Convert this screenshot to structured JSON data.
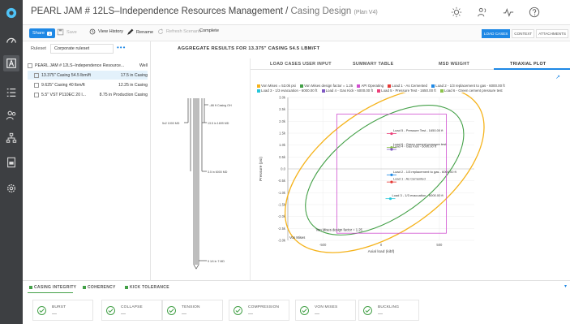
{
  "header": {
    "title": "PEARL JAM # 12LS–Independence Resources Management",
    "separator": " / ",
    "crumb": "Casing Design",
    "plan": "(Plan V4)"
  },
  "toolbar": {
    "share_label": "Share",
    "share_count": "1",
    "save_label": "Save",
    "history_label": "View History",
    "rename_label": "Rename",
    "refresh_label": "Refresh Scenario",
    "complete_label": "Complete",
    "right_tabs": [
      "LOAD CASES",
      "CONTEXT",
      "ATTACHMENTS"
    ]
  },
  "left_panel": {
    "ruleset_label": "Ruleset",
    "ruleset_value": "Corporate ruleset",
    "menu_glyph": "•••",
    "tree": [
      {
        "name": "PEARL JAM # 12LS–Independence Resource...",
        "value": "Well"
      },
      {
        "name": "13.375\" Casing 54.5 lbm/ft",
        "value": "17.5 in  Casing"
      },
      {
        "name": "9.625\" Casing 40 lbm/ft",
        "value": "12.25 in  Casing"
      },
      {
        "name": "5.5\" VST P110EC 20 l...",
        "value": "8.75 in  Production Casing"
      }
    ]
  },
  "main": {
    "title": "AGGREGATE RESULTS FOR 13.375\" CASING 54.5 LBM/FT"
  },
  "wellbore": {
    "labels": [
      "–86 ft Casing OH",
      "5x2 1000 MD",
      "13.5 in 1699 MD",
      "3.5 in 6000 MD",
      "9 1⁄4 in 7 MD"
    ]
  },
  "chart_tabs": [
    "LOAD CASES USER INPUT",
    "SUMMARY TABLE",
    "MSD WEIGHT",
    "TRIAXIAL PLOT"
  ],
  "expand_glyph": "↗",
  "legend": [
    {
      "label": "Von Mises = 53.0k psi",
      "color": "#f5b31c"
    },
    {
      "label": "Von Mises design factor = 1.25",
      "color": "#43a047"
    },
    {
      "label": "API Operating",
      "color": "#d04fd0"
    },
    {
      "label": "Load 1 - As Cemented",
      "color": "#e53935"
    },
    {
      "label": "Load 2 - 1/3 replacement to gas - 6000.00 ft",
      "color": "#1e88e5"
    },
    {
      "label": "Load 3 - 1/3 evacuation - 6000.00 ft",
      "color": "#26c6da"
    },
    {
      "label": "Load 4 - Gas Kick - 6000.00 ft",
      "color": "#7e57c2"
    },
    {
      "label": "Load 5 - Pressure Test - 1650.00 ft",
      "color": "#ec407a"
    },
    {
      "label": "Load 6 - Green cement pressure test",
      "color": "#8bc34a"
    }
  ],
  "chart_data": {
    "type": "scatter",
    "xlabel": "Axial load (kibf)",
    "ylabel": "Pressure (psi)",
    "x_ticks": [
      "-500",
      "0",
      "500"
    ],
    "y_ticks": [
      "3.0k",
      "2.5k",
      "2.0k",
      "1.5k",
      "1.0k",
      "0.5k",
      "0.0",
      "-0.5k",
      "-1.0k",
      "-1.5k",
      "-2.0k",
      "-2.5k",
      "-3.0k"
    ],
    "xlim": [
      -800,
      800
    ],
    "ylim": [
      -3000,
      3000
    ],
    "grid": true,
    "corner_label": "Von Mises",
    "envelope_label": "Von Mises design factor = 1.25",
    "points": [
      {
        "label": "Load 5 - Pressure Test - 1650.00 ft",
        "x": 90,
        "y": 1480,
        "color": "#ec407a"
      },
      {
        "label": "Load 6 - Green cement pressure test",
        "x": 90,
        "y": 900,
        "color": "#8bc34a"
      },
      {
        "label": "Load 4 - Gas Kick - 6000.00 ft",
        "x": 90,
        "y": 820,
        "color": "#7e57c2"
      },
      {
        "label": "Load 2 - 1/3 replacement to gas - 6000.00 ft",
        "x": 90,
        "y": -250,
        "color": "#1e88e5"
      },
      {
        "label": "Load 1 - As Cemented",
        "x": 90,
        "y": -550,
        "color": "#e53935"
      },
      {
        "label": "Load 3 - 1/3 evacuation - 6000.00 ft",
        "x": 80,
        "y": -1250,
        "color": "#26c6da"
      }
    ]
  },
  "bottom": {
    "tabs": [
      "CASING INTEGRITY",
      "COHERENCY",
      "KICK TOLERANCE"
    ],
    "dropdown_glyph": "▾",
    "cards": [
      {
        "label": "BURST",
        "value": "---"
      },
      {
        "label": "COLLAPSE",
        "value": "---"
      },
      {
        "label": "TENSION",
        "value": "---"
      },
      {
        "label": "COMPRESSION",
        "value": "---"
      },
      {
        "label": "VON MISES",
        "value": "---"
      },
      {
        "label": "BUCKLING",
        "value": "---"
      }
    ]
  }
}
